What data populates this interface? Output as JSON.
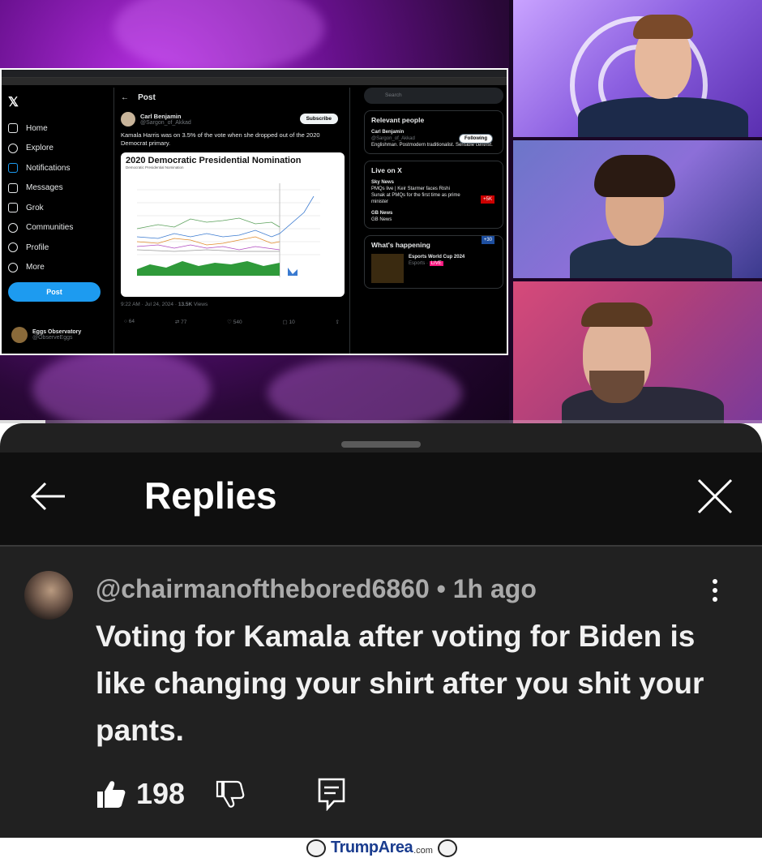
{
  "video": {
    "progress_fraction": 0.06,
    "x_post": {
      "nav_items": [
        "Home",
        "Explore",
        "Notifications",
        "Messages",
        "Grok",
        "Communities",
        "Profile",
        "More"
      ],
      "post_button": "Post",
      "header": "Post",
      "author_name": "Carl Benjamin",
      "author_handle": "@Sargon_of_Akkad",
      "subscribe_label": "Subscribe",
      "text": "Kamala Harris was on 3.5% of the vote when she dropped out of the 2020 Democrat primary.",
      "chart_title": "2020 Democratic Presidential Nomination",
      "chart_subtitle": "Democratic Presidential Nomination",
      "post_meta_time": "9:22 AM · Jul 24, 2024 ·",
      "post_meta_views": "13.5K",
      "post_meta_views_label": "Views",
      "counts": [
        "64",
        "77",
        "540",
        "10"
      ],
      "account_name": "Eggs Observatory",
      "account_handle": "@ObserveEggs",
      "search_placeholder": "Search",
      "relevant_people_title": "Relevant people",
      "relevant_name": "Carl Benjamin",
      "relevant_handle": "@Sargon_of_Akkad",
      "relevant_bio": "Englishman. Postmodern traditionalist. Sensible centrist.",
      "following_label": "Following",
      "live_title": "Live on X",
      "live_1_source": "Sky News",
      "live_1_text": "PMQs live | Keir Starmer faces Rishi Sunak at PMQs for the first time as prime minister",
      "live_1_badge": "+5K",
      "live_2_source": "GB News",
      "live_2_text": "GB News",
      "live_2_badge": "+30",
      "happening_title": "What's happening",
      "happening_item": "Esports World Cup 2024",
      "happening_sub": "Esports",
      "happening_live": "LIVE"
    }
  },
  "replies": {
    "title": "Replies",
    "comment": {
      "author": "@chairmanofthebored6860",
      "separator": " • ",
      "time": "1h ago",
      "text": "Voting for Kamala after voting for Biden is like changing your shirt after you shit your pants.",
      "likes": "198"
    }
  },
  "watermark": {
    "name": "TrumpArea",
    "tld": ".com"
  },
  "colors": {
    "panel_bg": "#212121",
    "header_bg": "#0f0f0f",
    "x_blue": "#1d9bf0"
  }
}
